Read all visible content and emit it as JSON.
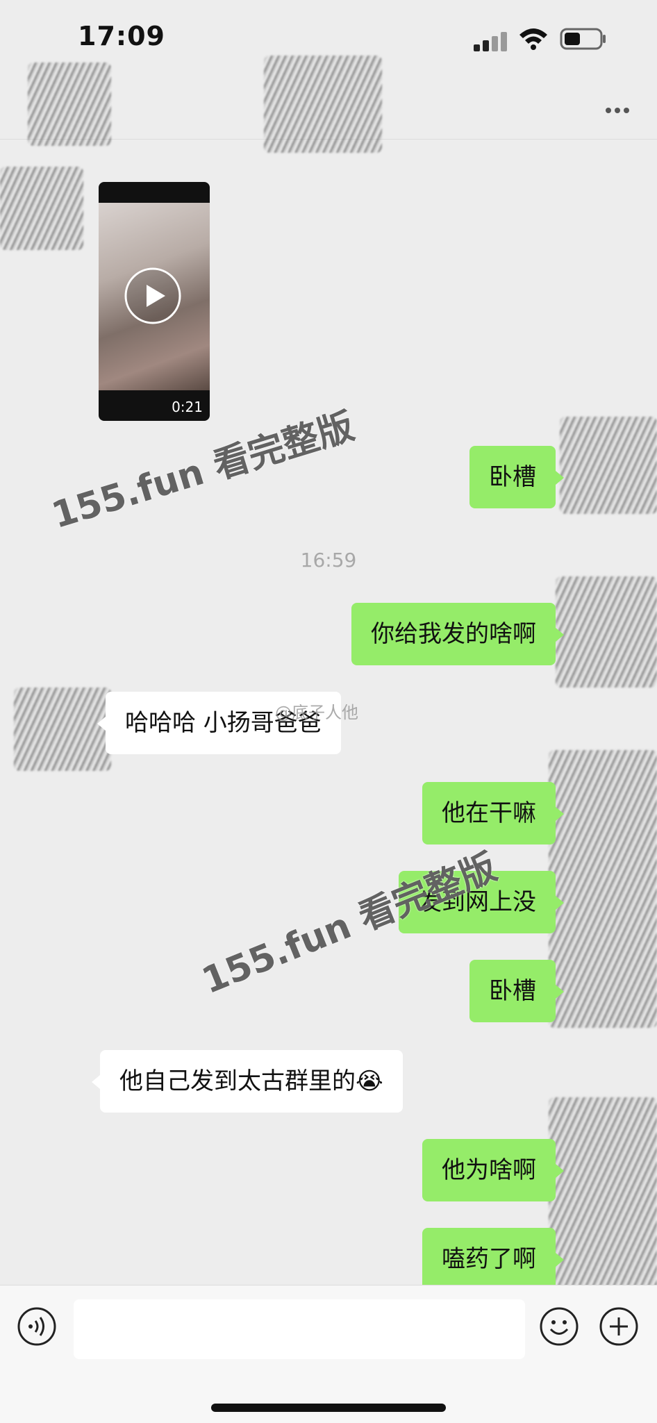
{
  "status_bar": {
    "time": "17:09",
    "signal_icon": "signal-icon",
    "wifi_icon": "wifi-icon",
    "battery_icon": "battery-icon"
  },
  "nav_bar": {
    "more_icon": "more-icon"
  },
  "video": {
    "duration": "0:21",
    "icon": "play-icon"
  },
  "messages": [
    {
      "side": "sent",
      "text": "卧槽"
    },
    {
      "side": "sent",
      "text": "你给我发的啥啊"
    },
    {
      "side": "received",
      "text": "哈哈哈 小扬哥爸爸"
    },
    {
      "side": "sent",
      "text": "他在干嘛"
    },
    {
      "side": "sent",
      "text": "发到网上没"
    },
    {
      "side": "sent",
      "text": "卧槽"
    },
    {
      "side": "received",
      "text": "他自己发到太古群里的😭"
    },
    {
      "side": "sent",
      "text": "他为啥啊"
    },
    {
      "side": "sent",
      "text": "嗑药了啊"
    }
  ],
  "timestamp": "16:59",
  "watermarks": [
    "155.fun 看完整版",
    "155.fun 看完整版"
  ],
  "weibo_watermark": "@底子人他",
  "input_bar": {
    "voice_icon": "voice-icon",
    "emoji_icon": "emoji-icon",
    "plus_icon": "plus-icon",
    "input_value": ""
  },
  "colors": {
    "sent_bubble": "#95ec69",
    "received_bubble": "#ffffff",
    "background": "#ededed"
  }
}
